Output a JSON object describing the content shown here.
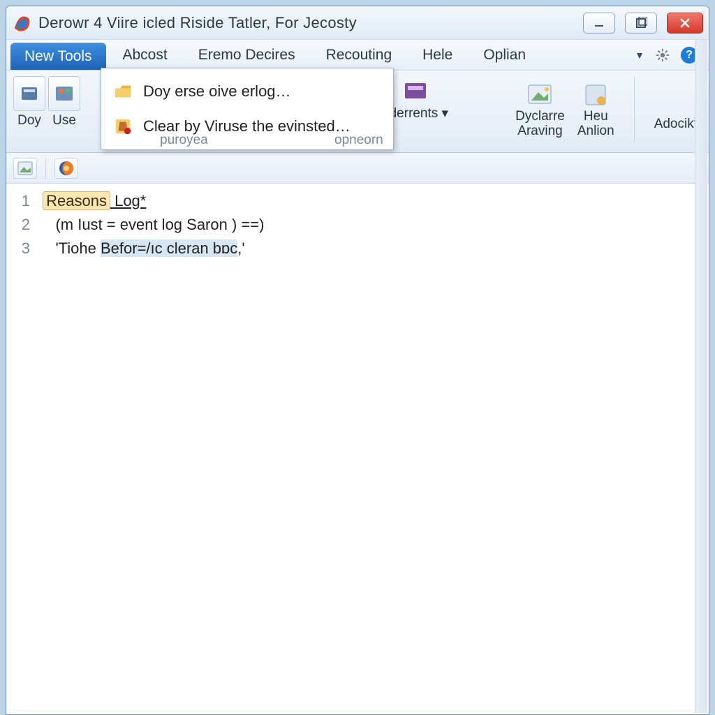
{
  "title": "Derowr 4 Viire icled Riside Tatler, For Jecosty",
  "menu": {
    "tabs": [
      "New Tools",
      "Abcost",
      "Eremo Decires",
      "Recouting",
      "Hele",
      "Oplian"
    ]
  },
  "dropdown": {
    "items": [
      "Doy erse oive erlog…",
      "Clear by Viruse the evinsted…"
    ]
  },
  "ribbon": {
    "left": [
      {
        "label": "Doy"
      },
      {
        "label": "Use"
      }
    ],
    "middle": [
      {
        "top": "",
        "bottom": "puroyea"
      },
      {
        "top": "nderrents ▾",
        "bottom": "opneorn"
      }
    ],
    "right": [
      {
        "line1": "Dyclarre",
        "line2": "Araving"
      },
      {
        "line1": "Heu",
        "line2": "Anlion"
      },
      {
        "line1": "Adocikt",
        "line2": ""
      }
    ]
  },
  "editor": {
    "gutter": [
      "1",
      "2",
      "3"
    ],
    "line1": {
      "hl": "Reasons",
      "rest": " Log*"
    },
    "line2": "    (m Iust = event log Saron ) ==)",
    "line3": {
      "pre": "    'Tiohe ",
      "sel": "Befor=/ıc cleran bɒc",
      "post": ",'"
    }
  }
}
